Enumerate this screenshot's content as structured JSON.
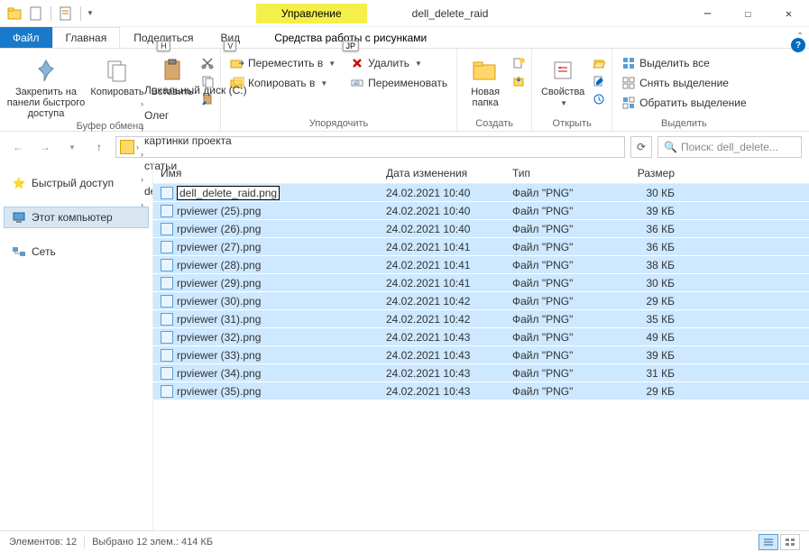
{
  "window": {
    "title": "dell_delete_raid",
    "context_tab": "Управление"
  },
  "tabs": {
    "file": "Файл",
    "home": "Главная",
    "share": "Поделиться",
    "view": "Вид",
    "context": "Средства работы с рисунками",
    "share_key": "H",
    "view_key": "V",
    "context_key": "JP"
  },
  "ribbon": {
    "clipboard": {
      "pin": "Закрепить на панели быстрого доступа",
      "copy": "Копировать",
      "paste": "Вставить",
      "label": "Буфер обмена"
    },
    "organize": {
      "move": "Переместить в",
      "copy_to": "Копировать в",
      "delete": "Удалить",
      "rename": "Переименовать",
      "label": "Упорядочить"
    },
    "new": {
      "folder": "Новая папка",
      "label": "Создать"
    },
    "open": {
      "props": "Свойства",
      "label": "Открыть"
    },
    "select": {
      "all": "Выделить все",
      "none": "Снять выделение",
      "invert": "Обратить выделение",
      "label": "Выделить"
    }
  },
  "breadcrumb": {
    "items": [
      "Локальный диск (C:)",
      "Олег",
      "картинки проекта",
      "статьи",
      "dell_delete_raid"
    ]
  },
  "search": {
    "placeholder": "Поиск: dell_delete..."
  },
  "sidebar": {
    "quick": "Быстрый доступ",
    "pc": "Этот компьютер",
    "network": "Сеть"
  },
  "columns": {
    "name": "Имя",
    "date": "Дата изменения",
    "type": "Тип",
    "size": "Размер"
  },
  "files": [
    {
      "name": "dell_delete_raid.png",
      "date": "24.02.2021 10:40",
      "type": "Файл \"PNG\"",
      "size": "30 КБ",
      "editing": true
    },
    {
      "name": "rpviewer (25).png",
      "date": "24.02.2021 10:40",
      "type": "Файл \"PNG\"",
      "size": "39 КБ"
    },
    {
      "name": "rpviewer (26).png",
      "date": "24.02.2021 10:40",
      "type": "Файл \"PNG\"",
      "size": "36 КБ"
    },
    {
      "name": "rpviewer (27).png",
      "date": "24.02.2021 10:41",
      "type": "Файл \"PNG\"",
      "size": "36 КБ"
    },
    {
      "name": "rpviewer (28).png",
      "date": "24.02.2021 10:41",
      "type": "Файл \"PNG\"",
      "size": "38 КБ"
    },
    {
      "name": "rpviewer (29).png",
      "date": "24.02.2021 10:41",
      "type": "Файл \"PNG\"",
      "size": "30 КБ"
    },
    {
      "name": "rpviewer (30).png",
      "date": "24.02.2021 10:42",
      "type": "Файл \"PNG\"",
      "size": "29 КБ"
    },
    {
      "name": "rpviewer (31).png",
      "date": "24.02.2021 10:42",
      "type": "Файл \"PNG\"",
      "size": "35 КБ"
    },
    {
      "name": "rpviewer (32).png",
      "date": "24.02.2021 10:43",
      "type": "Файл \"PNG\"",
      "size": "49 КБ"
    },
    {
      "name": "rpviewer (33).png",
      "date": "24.02.2021 10:43",
      "type": "Файл \"PNG\"",
      "size": "39 КБ"
    },
    {
      "name": "rpviewer (34).png",
      "date": "24.02.2021 10:43",
      "type": "Файл \"PNG\"",
      "size": "31 КБ"
    },
    {
      "name": "rpviewer (35).png",
      "date": "24.02.2021 10:43",
      "type": "Файл \"PNG\"",
      "size": "29 КБ"
    }
  ],
  "status": {
    "count": "Элементов: 12",
    "selected": "Выбрано 12 элем.: 414 КБ"
  }
}
